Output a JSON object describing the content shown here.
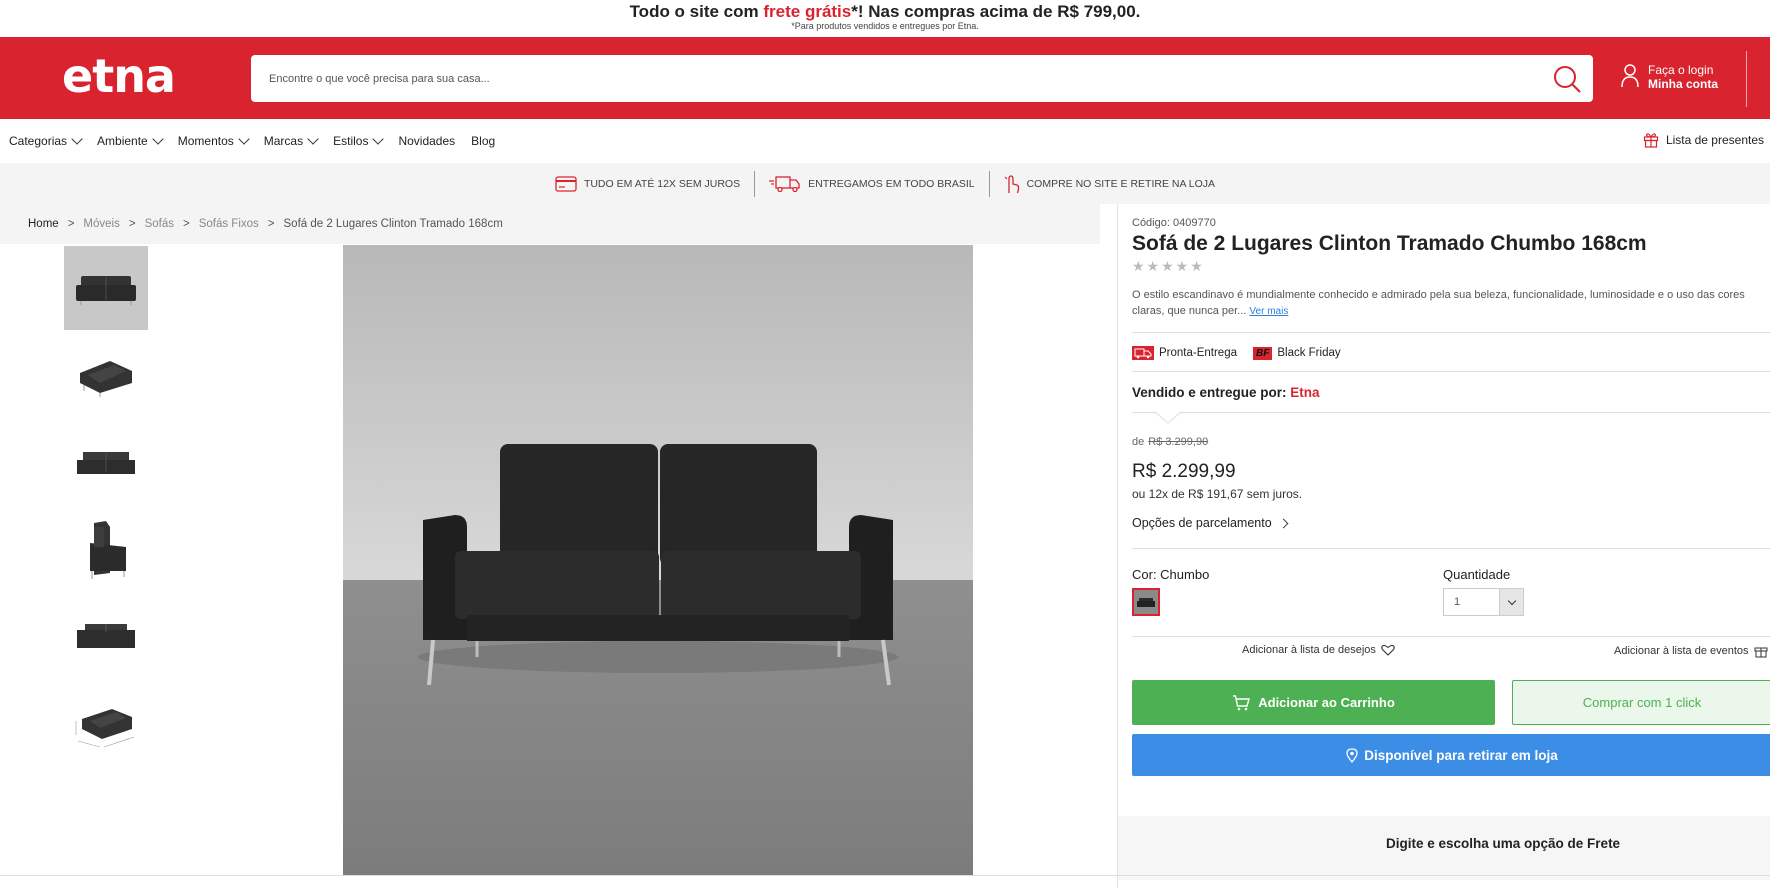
{
  "promo": {
    "prefix": "Todo o site com ",
    "highlight": "frete grátis",
    "suffix": "*! Nas compras acima de R$ 799,00.",
    "note": "*Para produtos vendidos e entregues por Etna."
  },
  "header": {
    "logo": "etna",
    "search_placeholder": "Encontre o que você precisa para sua casa...",
    "login_label": "Faça o login",
    "account_label": "Minha conta"
  },
  "nav": {
    "items": [
      "Categorias",
      "Ambiente",
      "Momentos",
      "Marcas",
      "Estilos",
      "Novidades",
      "Blog"
    ],
    "gift_list": "Lista de presentes"
  },
  "benefits": [
    "TUDO EM ATÉ 12X SEM JUROS",
    "ENTREGAMOS EM TODO BRASIL",
    "COMPRE NO SITE E RETIRE NA LOJA"
  ],
  "breadcrumb": [
    "Home",
    "Móveis",
    "Sofás",
    "Sofás Fixos",
    "Sofá de 2 Lugares Clinton Tramado 168cm"
  ],
  "product": {
    "code_label": "Código:",
    "code": "0409770",
    "title": "Sofá de 2 Lugares Clinton Tramado Chumbo 168cm",
    "stars": "★★★★★",
    "description": "O estilo escandinavo é mundialmente conhecido e admirado pela sua beleza, funcionalidade, luminosidade e o uso das cores claras, que nunca per...",
    "see_more": "Ver mais",
    "badges": [
      "Pronta-Entrega",
      "Black Friday"
    ],
    "badge_bf_text": "BF",
    "sold_by_label": "Vendido e entregue por: ",
    "seller": "Etna",
    "from_label": "de",
    "old_price": "R$ 3.299,90",
    "price": "R$ 2.299,99",
    "installments": "ou 12x de R$ 191,67 sem juros.",
    "payment_options": "Opções de parcelamento",
    "color_label": "Cor: Chumbo",
    "quantity_label": "Quantidade",
    "quantity_value": "1",
    "wishlist": "Adicionar à lista de desejos",
    "events": "Adicionar à lista de eventos",
    "add_to_cart": "Adicionar ao Carrinho",
    "buy_one_click": "Comprar com 1 click",
    "store_pickup": "Disponível para retirar em loja",
    "freight": "Digite e escolha uma opção de Frete"
  },
  "colors": {
    "brand_red": "#d9242f",
    "cart_green": "#4db052",
    "pickup_blue": "#3b8de6"
  }
}
